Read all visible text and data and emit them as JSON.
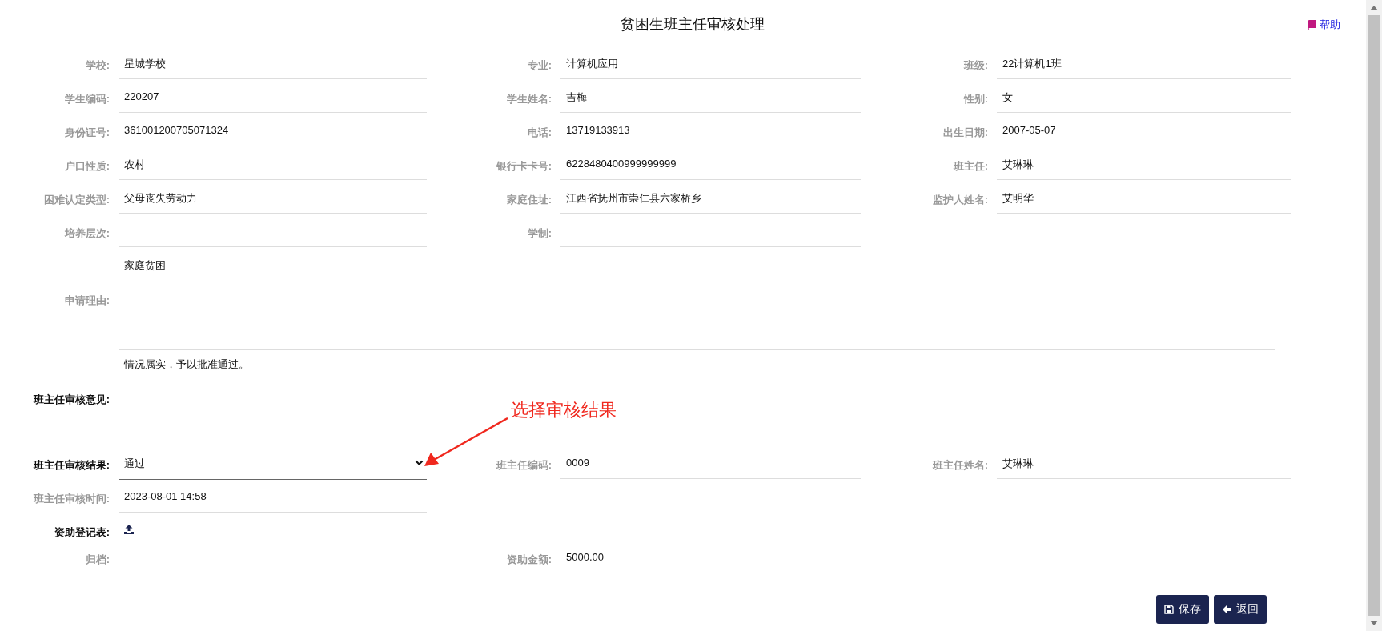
{
  "page": {
    "title": "贫困生班主任审核处理",
    "help": "帮助"
  },
  "rows": [
    {
      "fields": [
        {
          "kind": "text",
          "label": "学校:",
          "value": "星城学校",
          "editable": false
        },
        {
          "kind": "text",
          "label": "专业:",
          "value": "计算机应用",
          "editable": false
        },
        {
          "kind": "text",
          "label": "班级:",
          "value": "22计算机1班",
          "editable": false
        }
      ]
    },
    {
      "fields": [
        {
          "kind": "text",
          "label": "学生编码:",
          "value": "220207",
          "editable": false
        },
        {
          "kind": "text",
          "label": "学生姓名:",
          "value": "吉梅",
          "editable": false
        },
        {
          "kind": "text",
          "label": "性别:",
          "value": "女",
          "editable": false
        }
      ]
    },
    {
      "fields": [
        {
          "kind": "text",
          "label": "身份证号:",
          "value": "361001200705071324",
          "editable": false
        },
        {
          "kind": "text",
          "label": "电话:",
          "value": "13719133913",
          "editable": false
        },
        {
          "kind": "text",
          "label": "出生日期:",
          "value": "2007-05-07",
          "editable": false
        }
      ]
    },
    {
      "fields": [
        {
          "kind": "text",
          "label": "户口性质:",
          "value": "农村",
          "editable": false
        },
        {
          "kind": "text",
          "label": "银行卡卡号:",
          "value": "6228480400999999999",
          "editable": false
        },
        {
          "kind": "text",
          "label": "班主任:",
          "value": "艾琳琳",
          "editable": false
        }
      ]
    },
    {
      "fields": [
        {
          "kind": "text",
          "label": "困难认定类型:",
          "value": "父母丧失劳动力",
          "editable": false
        },
        {
          "kind": "text",
          "label": "家庭住址:",
          "value": "江西省抚州市崇仁县六家桥乡",
          "editable": false
        },
        {
          "kind": "text",
          "label": "监护人姓名:",
          "value": "艾明华",
          "editable": false
        }
      ]
    },
    {
      "fields": [
        {
          "kind": "text",
          "label": "培养层次:",
          "editable": false
        },
        {
          "kind": "text",
          "label": "学制:",
          "editable": false
        }
      ]
    },
    {
      "fields": [
        {
          "kind": "textarea",
          "label": "申请理由:",
          "value": "家庭贫困",
          "editable": false
        }
      ]
    },
    {
      "fields": [
        {
          "kind": "textarea",
          "label": "班主任审核意见:",
          "value": "情况属实，予以批准通过。",
          "editable": true
        }
      ]
    },
    {
      "fields": [
        {
          "kind": "select",
          "label": "班主任审核结果:",
          "value": "通过",
          "editable": true
        },
        {
          "kind": "text",
          "label": "班主任编码:",
          "value": "0009",
          "editable": false
        },
        {
          "kind": "text",
          "label": "班主任姓名:",
          "value": "艾琳琳",
          "editable": false
        }
      ]
    },
    {
      "fields": [
        {
          "kind": "text",
          "label": "班主任审核时间:",
          "value": "2023-08-01 14:58",
          "editable": false
        }
      ]
    },
    {
      "fields": [
        {
          "kind": "upload",
          "label": "资助登记表:",
          "editable": true
        }
      ]
    },
    {
      "fields": [
        {
          "kind": "text",
          "label": "归档:",
          "editable": false
        },
        {
          "kind": "text",
          "label": "资助金额:",
          "value": "5000.00",
          "editable": false
        }
      ]
    }
  ],
  "annotation": {
    "text": "选择审核结果"
  },
  "buttons": [
    {
      "kind": "save",
      "label": "保存"
    },
    {
      "kind": "back",
      "label": "返回"
    }
  ]
}
